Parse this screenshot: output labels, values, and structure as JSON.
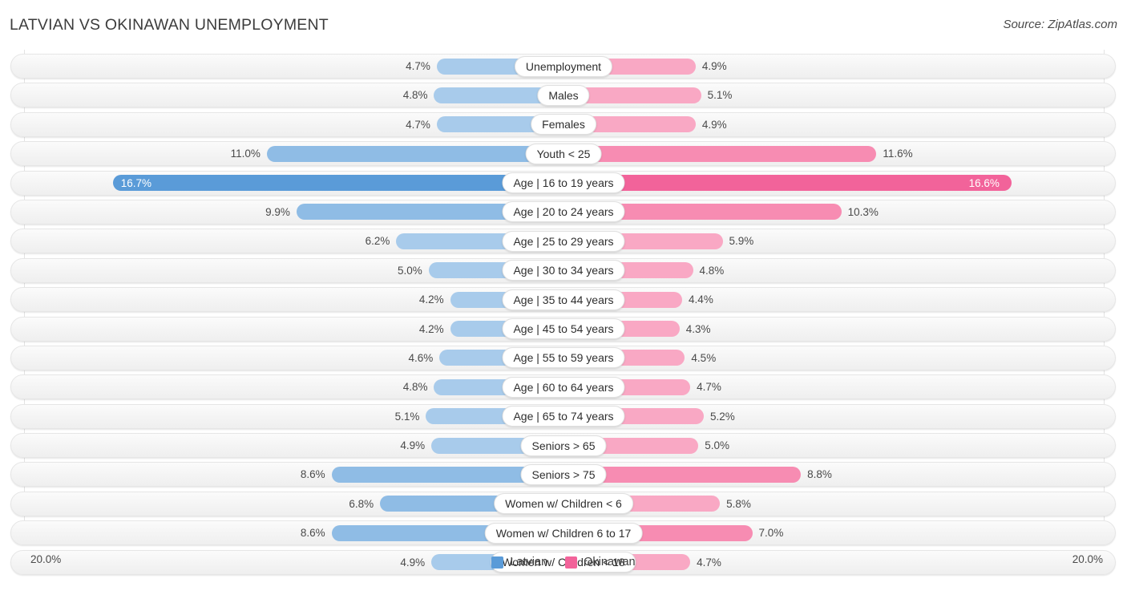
{
  "header": {
    "title": "LATVIAN VS OKINAWAN UNEMPLOYMENT",
    "source": "Source: ZipAtlas.com"
  },
  "axis": {
    "left_max_label": "20.0%",
    "right_max_label": "20.0%"
  },
  "legend": {
    "items": [
      {
        "label": "Latvian",
        "color": "#5a9bd8"
      },
      {
        "label": "Okinawan",
        "color": "#f2639a"
      }
    ]
  },
  "colors": {
    "latvian_light": "#a8cbeb",
    "latvian_mid": "#8fbce5",
    "latvian_dark": "#5a9bd8",
    "okinawan_light": "#f9a8c4",
    "okinawan_mid": "#f78cb2",
    "okinawan_dark": "#f2639a",
    "track_bg": "#f4f4f4",
    "gridline": "#e3e3e3",
    "text": "#4a4a4a"
  },
  "chart_data": {
    "type": "bar",
    "orientation": "horizontal-diverging",
    "title": "LATVIAN VS OKINAWAN UNEMPLOYMENT",
    "xlabel": "",
    "ylabel": "",
    "axis_max": 20.0,
    "axis_unit": "%",
    "grid": true,
    "legend_position": "bottom-center",
    "categories": [
      "Unemployment",
      "Males",
      "Females",
      "Youth < 25",
      "Age | 16 to 19 years",
      "Age | 20 to 24 years",
      "Age | 25 to 29 years",
      "Age | 30 to 34 years",
      "Age | 35 to 44 years",
      "Age | 45 to 54 years",
      "Age | 55 to 59 years",
      "Age | 60 to 64 years",
      "Age | 65 to 74 years",
      "Seniors > 65",
      "Seniors > 75",
      "Women w/ Children < 6",
      "Women w/ Children 6 to 17",
      "Women w/ Children < 18"
    ],
    "series": [
      {
        "name": "Latvian",
        "side": "left",
        "color": "#5a9bd8",
        "values": [
          4.7,
          4.8,
          4.7,
          11.0,
          16.7,
          9.9,
          6.2,
          5.0,
          4.2,
          4.2,
          4.6,
          4.8,
          5.1,
          4.9,
          8.6,
          6.8,
          8.6,
          4.9
        ],
        "labels": [
          "4.7%",
          "4.8%",
          "4.7%",
          "11.0%",
          "16.7%",
          "9.9%",
          "6.2%",
          "5.0%",
          "4.2%",
          "4.2%",
          "4.6%",
          "4.8%",
          "5.1%",
          "4.9%",
          "8.6%",
          "6.8%",
          "8.6%",
          "4.9%"
        ]
      },
      {
        "name": "Okinawan",
        "side": "right",
        "color": "#f2639a",
        "values": [
          4.9,
          5.1,
          4.9,
          11.6,
          16.6,
          10.3,
          5.9,
          4.8,
          4.4,
          4.3,
          4.5,
          4.7,
          5.2,
          5.0,
          8.8,
          5.8,
          7.0,
          4.7
        ],
        "labels": [
          "4.9%",
          "5.1%",
          "4.9%",
          "11.6%",
          "16.6%",
          "10.3%",
          "5.9%",
          "4.8%",
          "4.4%",
          "4.3%",
          "4.5%",
          "4.7%",
          "5.2%",
          "5.0%",
          "8.8%",
          "5.8%",
          "7.0%",
          "4.7%"
        ]
      }
    ]
  }
}
